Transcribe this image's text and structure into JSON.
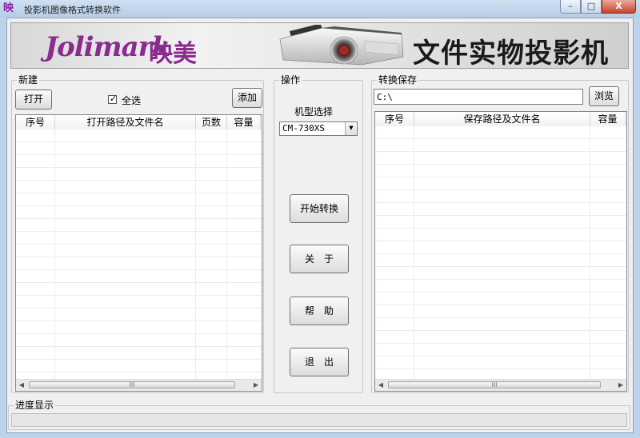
{
  "window": {
    "title": "投影机图像格式转换软件",
    "icon_text": "映",
    "buttons": {
      "minimize": "–",
      "maximize": "□",
      "close": "X"
    }
  },
  "banner": {
    "brand_latin": "Jolimark",
    "brand_cn": "映美",
    "product_title": "文件实物投影机"
  },
  "new_panel": {
    "title": "新建",
    "open_button": "打开",
    "select_all_label": "全选",
    "select_all_checked": true,
    "add_button": "添加",
    "columns": [
      "序号",
      "打开路径及文件名",
      "页数",
      "容量"
    ],
    "rows": [],
    "scroll_thumb": "III"
  },
  "ops_panel": {
    "title": "操作",
    "model_label": "机型选择",
    "model_value": "CM-730XS",
    "start_button": "开始转换",
    "about_button": "关　于",
    "help_button": "帮　助",
    "exit_button": "退　出"
  },
  "save_panel": {
    "title": "转换保存",
    "path_value": "C:\\",
    "browse_button": "浏览",
    "columns": [
      "序号",
      "保存路径及文件名",
      "容量"
    ],
    "rows": [],
    "scroll_thumb": "III"
  },
  "progress_panel": {
    "title": "进度显示",
    "progress": 0
  },
  "icons": [
    "app-logo-icon",
    "minimize-icon",
    "maximize-icon",
    "close-icon",
    "dropdown-arrow-icon",
    "scroll-left-icon",
    "scroll-right-icon"
  ],
  "colors": {
    "brand_purple": "#8a2b8e",
    "title_bar": "#bcd3ea",
    "client_bg": "#f0f0f0"
  }
}
